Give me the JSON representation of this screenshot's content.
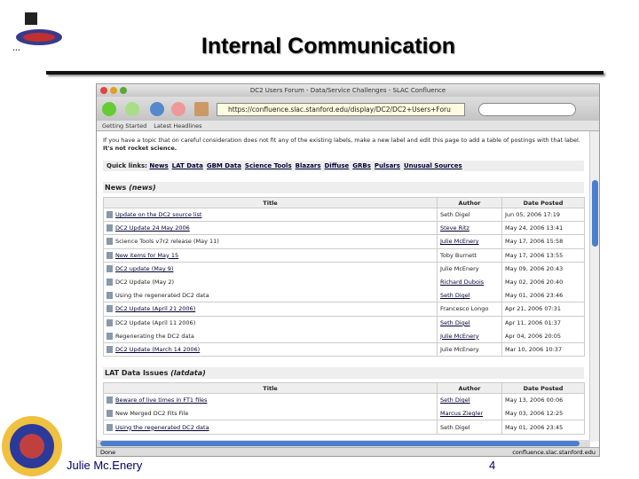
{
  "slide": {
    "title": "Internal Communication",
    "author": "Julie Mc.Enery",
    "page": "4"
  },
  "browser": {
    "window_title": "DC2 Users Forum - Data/Service Challenges - SLAC Confluence",
    "url": "https://confluence.slac.stanford.edu/display/DC2/DC2+Users+Foru",
    "bookmarks": [
      "Getting Started",
      "Latest Headlines"
    ],
    "status_left": "Done",
    "status_right": "confluence.slac.stanford.edu"
  },
  "page": {
    "intro": "If you have a topic that on careful consideration does not fit any of the existing labels, make a new label and edit this page to add a table of postings with that label.",
    "intro_bold": "It's not rocket science.",
    "quick_links_label": "Quick links:",
    "quick_links": [
      "News",
      "LAT Data",
      "GBM Data",
      "Science Tools",
      "Blazars",
      "Diffuse",
      "GRBs",
      "Pulsars",
      "Unusual Sources"
    ],
    "columns": [
      "Title",
      "Author",
      "Date Posted"
    ],
    "sections": [
      {
        "heading": "News",
        "label": "(news)",
        "rows": [
          {
            "title": "Update on the DC2 source list",
            "tl": true,
            "author": "Seth Digel",
            "al": false,
            "date": "Jun 05, 2006 17:19",
            "sep": true
          },
          {
            "title": "DC2 Update 24 May 2006",
            "tl": true,
            "author": "Steve Ritz",
            "al": true,
            "date": "May 24, 2006 13:41",
            "sep": true
          },
          {
            "title": "Science Tools v7r2 release (May 11)",
            "tl": false,
            "author": "Julie McEnery",
            "al": true,
            "date": "May 17, 2006 15:58",
            "sep": true
          },
          {
            "title": "New items for May 15",
            "tl": true,
            "author": "Toby Burnett",
            "al": false,
            "date": "May 17, 2006 13:55",
            "sep": true
          },
          {
            "title": "DC2 update (May 9)",
            "tl": true,
            "author": "Julie McEnery",
            "al": false,
            "date": "May 09, 2006 20:43",
            "sep": false
          },
          {
            "title": "DC2 Update (May 2)",
            "tl": false,
            "author": "Richard Dubois",
            "al": true,
            "date": "May 02, 2006 20:40",
            "sep": false
          },
          {
            "title": "Using the regenerated DC2 data",
            "tl": false,
            "author": "Seth Digel",
            "al": true,
            "date": "May 01, 2006 23:46",
            "sep": true
          },
          {
            "title": "DC2 Update (April 21 2006)",
            "tl": true,
            "author": "Francesco Longo",
            "al": false,
            "date": "Apr 21, 2006 07:31",
            "sep": true
          },
          {
            "title": "DC2 Update (April 11 2006)",
            "tl": false,
            "author": "Seth Digel",
            "al": true,
            "date": "Apr 11, 2006 01:37",
            "sep": false
          },
          {
            "title": "Regenerating the DC2 data",
            "tl": false,
            "author": "Julie McEnery",
            "al": true,
            "date": "Apr 04, 2006 20:05",
            "sep": true
          },
          {
            "title": "DC2 Update (March 14 2006)",
            "tl": true,
            "author": "Julie McEnery",
            "al": false,
            "date": "Mar 10, 2006 10:37",
            "sep": true
          }
        ]
      },
      {
        "heading": "LAT Data Issues",
        "label": "(latdata)",
        "rows": [
          {
            "title": "Beware of live times in FT1 files",
            "tl": true,
            "author": "Seth Digel",
            "al": true,
            "date": "May 13, 2006 00:06",
            "sep": false
          },
          {
            "title": "New Merged DC2 Fits File",
            "tl": false,
            "author": "Marcus Ziegler",
            "al": true,
            "date": "May 03, 2006 12:25",
            "sep": true
          },
          {
            "title": "Using the regenerated DC2 data",
            "tl": true,
            "author": "Seth Digel",
            "al": false,
            "date": "May 01, 2006 23:45",
            "sep": true
          }
        ]
      }
    ]
  },
  "colors": {
    "accent": "#4a7fd0",
    "link": "#000033",
    "slide_text": "#000066"
  }
}
